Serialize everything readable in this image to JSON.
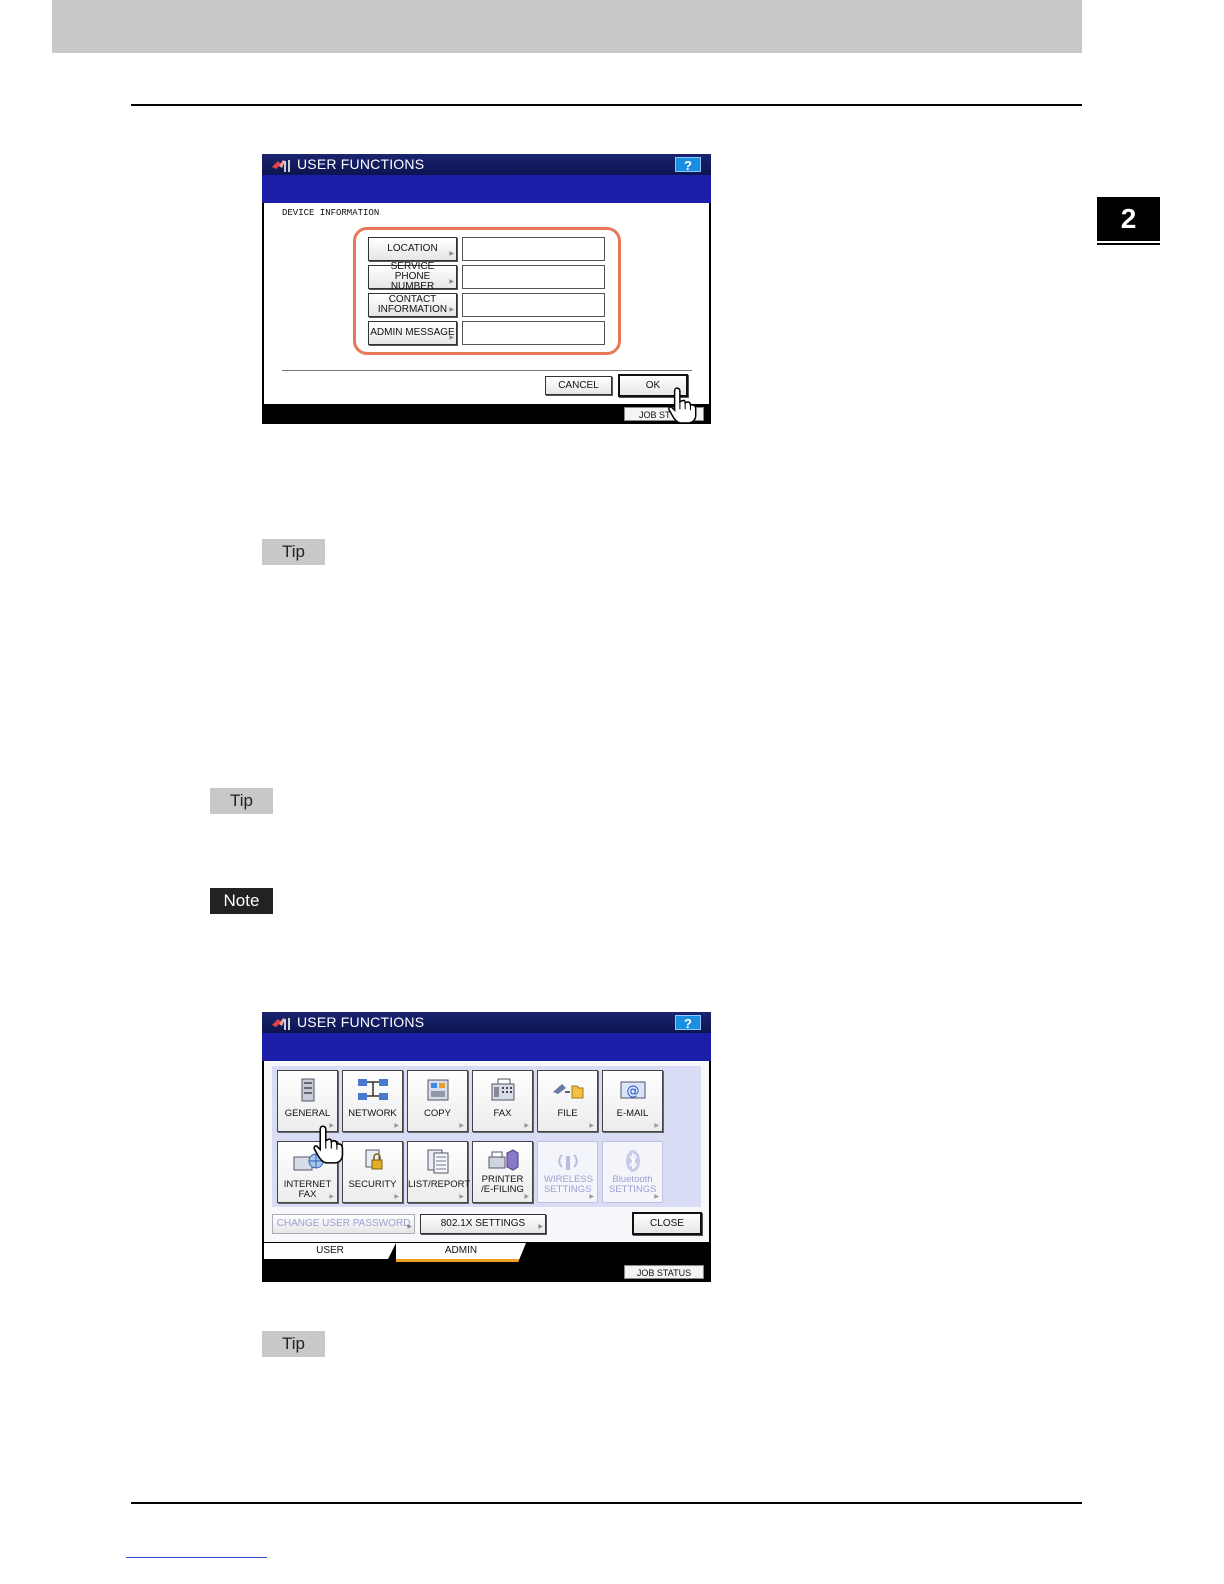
{
  "chapter_number": "2",
  "badges": {
    "tip1": "Tip",
    "tip2": "Tip",
    "note": "Note",
    "tip3": "Tip"
  },
  "screen1": {
    "title": "USER FUNCTIONS",
    "help": "?",
    "section_label": "DEVICE INFORMATION",
    "rows": [
      {
        "label": "LOCATION",
        "value": ""
      },
      {
        "label": "SERVICE PHONE NUMBER",
        "value": ""
      },
      {
        "label": "CONTACT INFORMATION",
        "value": ""
      },
      {
        "label": "ADMIN MESSAGE",
        "value": ""
      }
    ],
    "cancel": "CANCEL",
    "ok": "OK",
    "job_status": "JOB ST"
  },
  "screen2": {
    "title": "USER FUNCTIONS",
    "help": "?",
    "tiles": [
      {
        "label": "GENERAL",
        "icon": "general-icon",
        "enabled": true
      },
      {
        "label": "NETWORK",
        "icon": "network-icon",
        "enabled": true
      },
      {
        "label": "COPY",
        "icon": "copy-icon",
        "enabled": true
      },
      {
        "label": "FAX",
        "icon": "fax-icon",
        "enabled": true
      },
      {
        "label": "FILE",
        "icon": "file-icon",
        "enabled": true
      },
      {
        "label": "E-MAIL",
        "icon": "email-icon",
        "enabled": true
      },
      {
        "label": "INTERNET FAX",
        "icon": "internet-fax-icon",
        "enabled": true
      },
      {
        "label": "SECURITY",
        "icon": "security-icon",
        "enabled": true
      },
      {
        "label": "LIST/REPORT",
        "icon": "list-report-icon",
        "enabled": true
      },
      {
        "label": "PRINTER /E-FILING",
        "icon": "printer-efiling-icon",
        "enabled": true
      },
      {
        "label": "WIRELESS SETTINGS",
        "icon": "wireless-icon",
        "enabled": false
      },
      {
        "label": "Bluetooth SETTINGS",
        "icon": "bluetooth-icon",
        "enabled": false
      }
    ],
    "change_password": "CHANGE USER PASSWORD",
    "settings_8021x": "802.1X SETTINGS",
    "close": "CLOSE",
    "tab_user": "USER",
    "tab_admin": "ADMIN",
    "job_status": "JOB STATUS"
  }
}
